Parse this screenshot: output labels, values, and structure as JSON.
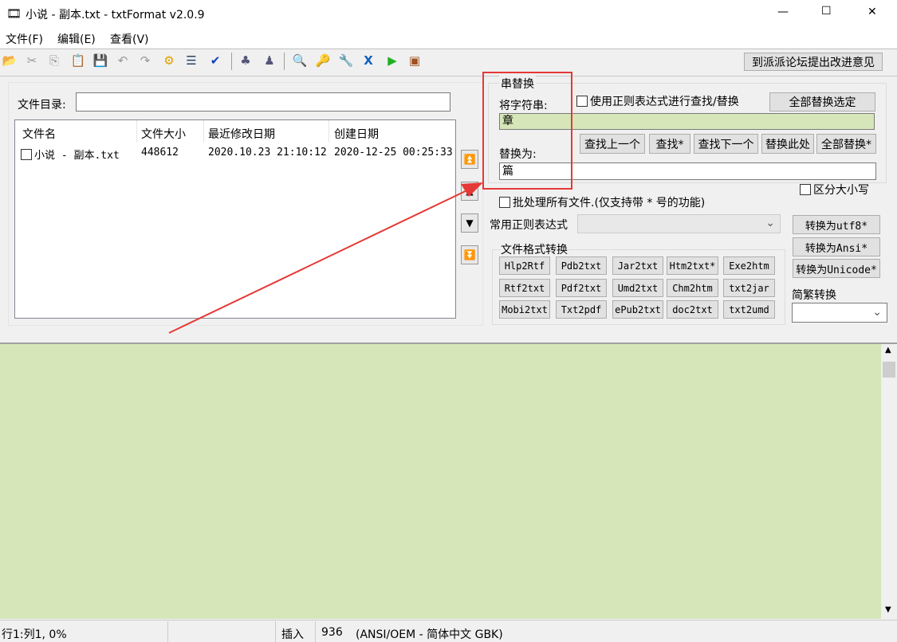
{
  "window": {
    "title": "小说 - 副本.txt - txtFormat v2.0.9",
    "minimize": "—",
    "maximize": "☐",
    "close": "✕",
    "app_icon": "film-icon"
  },
  "menu": [
    "文件(F)",
    "编辑(E)",
    "查看(V)"
  ],
  "toolbar": {
    "icons": [
      "open-folder-icon",
      "cut-icon",
      "copy-icon",
      "paste-icon",
      "save-icon",
      "undo-icon",
      "redo-icon",
      "gear-icon",
      "format-icon",
      "spellcheck-icon",
      "tree-icon",
      "person-icon",
      "search-replace-icon",
      "key-icon",
      "wrench-icon",
      "x-icon",
      "play-icon",
      "book-icon"
    ],
    "feedback": "到派派论坛提出改进意见"
  },
  "files": {
    "dir_label": "文件目录:",
    "dir_value": "",
    "columns": [
      "文件名",
      "文件大小",
      "最近修改日期",
      "创建日期"
    ],
    "rows": [
      {
        "name": "小说 - 副本.txt",
        "size": "448612",
        "modified": "2020.10.23 21:10:12",
        "created": "2020-12-25 00:25:33"
      }
    ]
  },
  "replace": {
    "group": "串替换",
    "find_label": "将字符串:",
    "find_value": "章",
    "replace_label": "替换为:",
    "replace_value": "篇",
    "regex": "使用正则表达式进行查找/替换",
    "replace_all_selected": "全部替换选定",
    "buttons": [
      "查找上一个",
      "查找*",
      "查找下一个",
      "替换此处",
      "全部替换*"
    ],
    "case": "区分大小写",
    "batch": "批处理所有文件.(仅支持带 * 号的功能)",
    "common_regex": "常用正则表达式"
  },
  "formats": {
    "group": "文件格式转换",
    "buttons": [
      [
        "Hlp2Rtf",
        "Pdb2txt",
        "Jar2txt",
        "Htm2txt*",
        "Exe2htm"
      ],
      [
        "Rtf2txt",
        "Pdf2txt",
        "Umd2txt",
        "Chm2htm",
        "txt2jar"
      ],
      [
        "Mobi2txt",
        "Txt2pdf",
        "ePub2txt",
        "doc2txt",
        "txt2umd"
      ]
    ]
  },
  "encoding": {
    "buttons": [
      "转换为utf8*",
      "转换为Ansi*",
      "转换为Unicode*"
    ],
    "jianfan": "简繁转换"
  },
  "status": {
    "pos": "行1:列1, 0%",
    "mode": "插入",
    "count": "936",
    "encoding": "(ANSI/OEM - 简体中文 GBK)"
  },
  "colors": {
    "text_area": "#d6e6b9",
    "find_bg": "#d6e6b9",
    "highlight": "#e53935"
  }
}
